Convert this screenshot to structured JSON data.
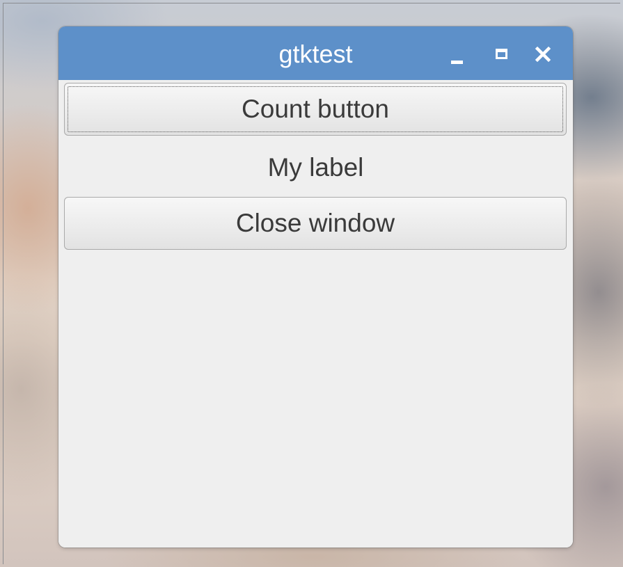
{
  "window": {
    "title": "gtktest"
  },
  "content": {
    "count_button_label": "Count button",
    "label_text": "My label",
    "close_button_label": "Close window"
  },
  "icons": {
    "minimize": "minimize-icon",
    "maximize": "maximize-icon",
    "close": "close-icon"
  },
  "colors": {
    "titlebar": "#5d90c9",
    "window_bg": "#efefef",
    "text": "#3a3a3a"
  }
}
